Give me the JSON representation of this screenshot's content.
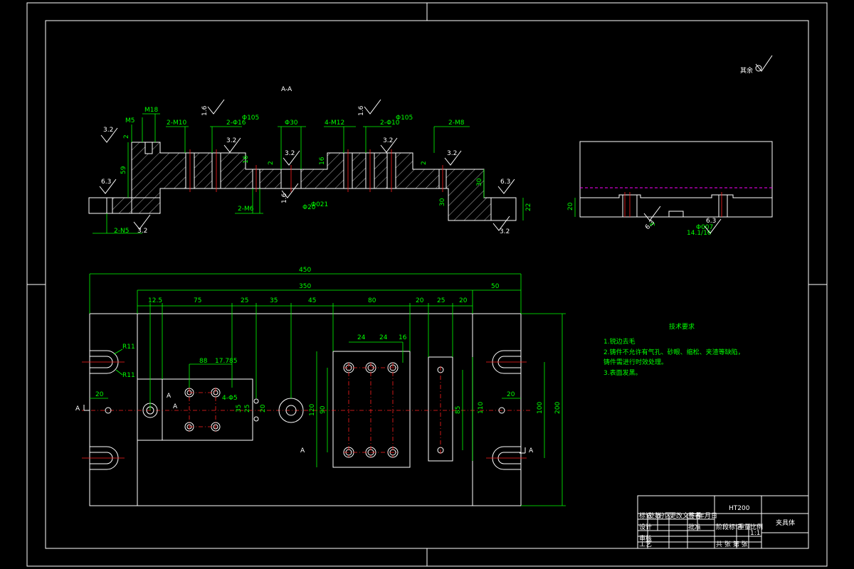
{
  "section_title": "A-A",
  "section_labels": {
    "m5": "M5",
    "m18": "M18",
    "n10": "2-M10",
    "phi16": "2-Φ16",
    "phi16_sup": "Φ105",
    "phi30": "Φ30",
    "m12": "4-M12",
    "phi10": "2-Φ10",
    "phi10_sup": "Φ105",
    "m8": "2-M8",
    "m6": "2-M6",
    "phi20": "Φ20",
    "phi20_sup": "Φ021",
    "n5": "2-N5"
  },
  "roughness": {
    "r32": "3.2",
    "r16": "1.6",
    "r63": "6.3",
    "general_mark": "其余"
  },
  "section_dims": {
    "d59": "59",
    "d2": "2",
    "d16": "16",
    "d30": "30",
    "d22": "22"
  },
  "side_view": {
    "d20": "20",
    "d5": "5",
    "d1416": "14.1/16",
    "phi007": "Φ007",
    "r63": "6.3"
  },
  "plan_dims": {
    "d450": "450",
    "d350": "350",
    "d50": "50",
    "d12_5": "12.5",
    "d75": "75",
    "d25a": "25",
    "d35": "35",
    "d45": "45",
    "d80": "80",
    "d20a": "20",
    "d25b": "25",
    "d20b": "20",
    "d88": "88",
    "d17785": "17.785",
    "d24a": "24",
    "d24b": "24",
    "d16": "16",
    "r11a": "R11",
    "r11b": "R11",
    "d20_left": "20",
    "d20_right": "20",
    "d100": "100",
    "d200": "200",
    "d120": "120",
    "d90": "90",
    "d85": "85",
    "d110": "110",
    "d35v": "35",
    "d25v": "25",
    "d20v": "20",
    "phi_small": "4-Φ5"
  },
  "section_marks": {
    "a_left": "A",
    "a_right": "A",
    "a_mid1": "A",
    "a_mid2": "A",
    "a_bottom": "A"
  },
  "tech_req": {
    "title": "技术要求",
    "lines": [
      "1.锐边去毛",
      "2.铸件不允许有气孔、砂眼、缩松、夹渣等缺陷，",
      "  铸件需进行时效处理。",
      "3.表面发黑。"
    ]
  },
  "title_block": {
    "material": "HT200",
    "part_name": "夹具体",
    "scale": "1:1",
    "row_labels": [
      "标记",
      "处数",
      "分区",
      "更改文件号",
      "签名",
      "年月日"
    ],
    "stage_labels": [
      "阶段标记",
      "重量",
      "比例"
    ],
    "design": "设计",
    "check": "审核",
    "approve": "批准",
    "process": "工艺",
    "sheet": "共 张  第 张"
  }
}
